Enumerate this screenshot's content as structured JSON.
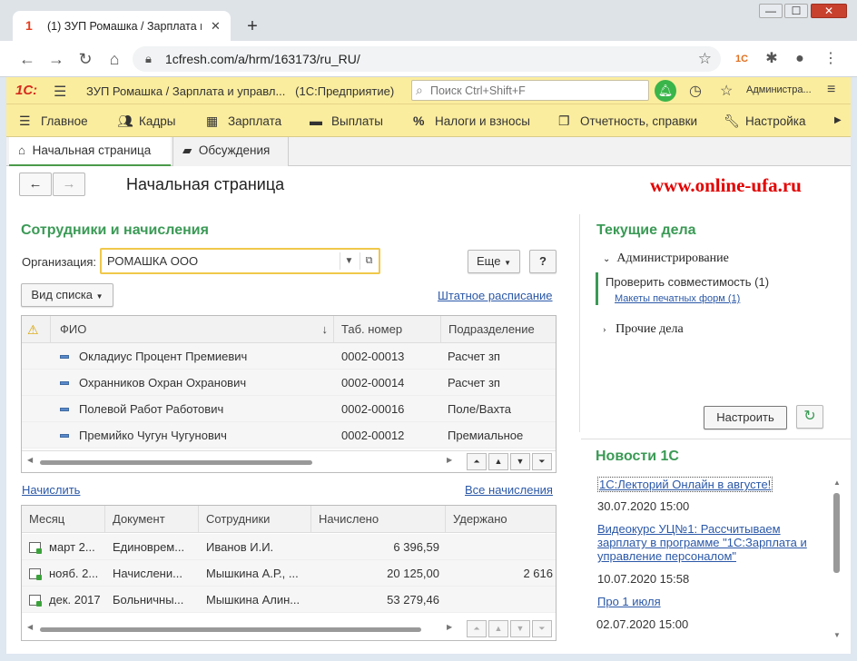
{
  "browser": {
    "tab_title": "(1) ЗУП Ромашка / Зарплата и у",
    "tab_favicon": "1",
    "url": "1cfresh.com/a/hrm/163173/ru_RU/"
  },
  "app": {
    "logo": "1С:",
    "title": "ЗУП Ромашка / Зарплата и управл...",
    "platform": "(1С:Предприятие)",
    "search_placeholder": "Поиск Ctrl+Shift+F",
    "user": "Администра..."
  },
  "menu": [
    {
      "label": "Главное",
      "icon": "hamburger-icon"
    },
    {
      "label": "Кадры",
      "icon": "people-icon"
    },
    {
      "label": "Зарплата",
      "icon": "calculator-icon"
    },
    {
      "label": "Выплаты",
      "icon": "wallet-icon"
    },
    {
      "label": "Налоги и взносы",
      "icon": "percent-icon"
    },
    {
      "label": "Отчетность, справки",
      "icon": "reports-icon"
    },
    {
      "label": "Настройка",
      "icon": "wrench-icon"
    }
  ],
  "page_tabs": [
    {
      "label": "Начальная страница",
      "active": true
    },
    {
      "label": "Обсуждения",
      "active": false
    }
  ],
  "page": {
    "title": "Начальная страница",
    "watermark": "www.online-ufa.ru"
  },
  "employees": {
    "heading": "Сотрудники и начисления",
    "org_label": "Организация:",
    "org_value": "РОМАШКА ООО",
    "more_label": "Еще",
    "help_label": "?",
    "view_label": "Вид списка",
    "staff_link": "Штатное расписание",
    "columns": [
      "ФИО",
      "Таб. номер",
      "Подразделение"
    ],
    "rows": [
      {
        "name": "Окладиус Процент Премиевич",
        "tab": "0002-00013",
        "dept": "Расчет зп"
      },
      {
        "name": "Охранников Охран Охранович",
        "tab": "0002-00014",
        "dept": "Расчет зп"
      },
      {
        "name": "Полевой Работ Работович",
        "tab": "0002-00016",
        "dept": "Поле/Вахта"
      },
      {
        "name": "Премийко Чугун Чугунович",
        "tab": "0002-00012",
        "dept": "Премиальное"
      }
    ],
    "scroll_position": 0.5
  },
  "accruals": {
    "accrue_link": "Начислить",
    "all_link": "Все начисления",
    "columns": [
      "Месяц",
      "Документ",
      "Сотрудники",
      "Начислено",
      "Удержано"
    ],
    "rows": [
      {
        "month": "март 2...",
        "doc": "Единоврем...",
        "emp": "Иванов И.И.",
        "accrued": "6 396,59",
        "withheld": ""
      },
      {
        "month": "нояб. 2...",
        "doc": "Начислени...",
        "emp": "Мышкина А.Р., ...",
        "accrued": "20 125,00",
        "withheld": "2 616"
      },
      {
        "month": "дек. 2017",
        "doc": "Больничны...",
        "emp": "Мышкина Алин...",
        "accrued": "53 279,46",
        "withheld": ""
      }
    ],
    "scroll_position": 0.73
  },
  "tasks": {
    "heading": "Текущие дела",
    "group1": "Администрирование",
    "item1": "Проверить совместимость (1)",
    "item1_sub": "Макеты печатных форм (1)",
    "group2": "Прочие дела",
    "configure_label": "Настроить"
  },
  "news": {
    "heading": "Новости 1С",
    "items": [
      {
        "title": "1С:Лекторий Онлайн в августе!",
        "date": "30.07.2020 15:00"
      },
      {
        "title_lines": [
          "Видеокурс УЦ№1: Рассчитываем",
          "зарплату в программе \"1С:Зарплата и",
          "управление персоналом\""
        ],
        "date": "10.07.2020 15:58"
      },
      {
        "title": "Про 1 июля",
        "date": "02.07.2020 15:00"
      }
    ]
  },
  "colors": {
    "accent_yellow": "#fbed9e",
    "heading_green": "#3a9a55",
    "brand_red": "#e30000",
    "link_blue": "#2b58a8"
  }
}
